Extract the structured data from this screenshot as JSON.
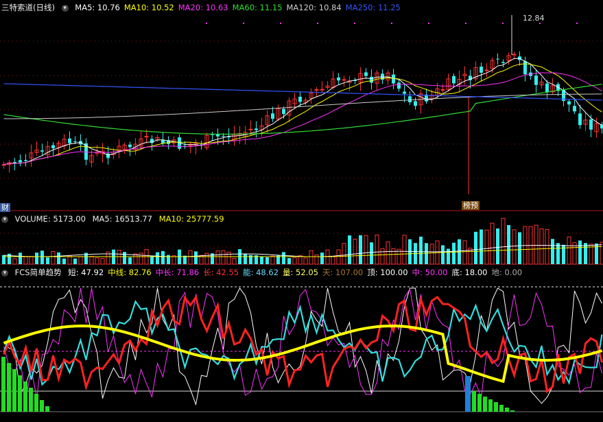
{
  "main_header": {
    "title": "三特索道(日线)",
    "ma": [
      {
        "label": "MA5: 10.76",
        "color": "#ffffff"
      },
      {
        "label": "MA10: 10.52",
        "color": "#ffff00"
      },
      {
        "label": "MA20: 10.63",
        "color": "#ff33ff"
      },
      {
        "label": "MA60: 11.15",
        "color": "#33dd33"
      },
      {
        "label": "MA120: 10.84",
        "color": "#cccccc"
      },
      {
        "label": "MA250: 11.25",
        "color": "#3355ff"
      }
    ]
  },
  "vol_header": {
    "title": "VOLUME: 5173.00",
    "ma5": "MA5: 16513.77",
    "ma10": "MA10: 25777.59"
  },
  "fcs_header": {
    "title": "FCS简单趋势",
    "items": [
      {
        "label": "短: 47.92",
        "color": "#ffffff"
      },
      {
        "label": "中线: 82.76",
        "color": "#ffff00"
      },
      {
        "label": "中长: 71.86",
        "color": "#ff33ff"
      },
      {
        "label": "长: 42.55",
        "color": "#ff3333"
      },
      {
        "label": "能: 48.62",
        "color": "#66ddff"
      },
      {
        "label": "量: 52.05",
        "color": "#ffff66"
      },
      {
        "label": "天: 107.00",
        "color": "#aa7733"
      },
      {
        "label": "顶: 100.00",
        "color": "#ffffff"
      },
      {
        "label": "中: 50.00",
        "color": "#ff33ff"
      },
      {
        "label": "底: 18.00",
        "color": "#ffffff"
      },
      {
        "label": "地: 0.00",
        "color": "#aaaaaa"
      }
    ]
  },
  "markers": {
    "high_label": "12.84",
    "cai_tag": "财",
    "bang_tag": "榜预"
  },
  "colors": {
    "up": "#ff3333",
    "down": "#33eeee",
    "grid": "#8a1a1a"
  },
  "chart_data": [
    {
      "type": "candlestick",
      "title": "三特索道(日线)",
      "high_annotation": 12.84,
      "series_names": [
        "MA5",
        "MA10",
        "MA20",
        "MA60",
        "MA120",
        "MA250"
      ]
    },
    {
      "type": "bar",
      "title": "VOLUME",
      "values_latest": 5173.0,
      "ma5": 16513.77,
      "ma10": 25777.59
    },
    {
      "type": "line",
      "title": "FCS简单趋势",
      "series_names": [
        "短",
        "中线",
        "中长",
        "长",
        "能",
        "量"
      ],
      "levels": {
        "天": 107.0,
        "顶": 100.0,
        "中": 50.0,
        "底": 18.0,
        "地": 0.0
      },
      "latest": {
        "短": 47.92,
        "中线": 82.76,
        "中长": 71.86,
        "长": 42.55,
        "能": 48.62,
        "量": 52.05
      }
    }
  ]
}
